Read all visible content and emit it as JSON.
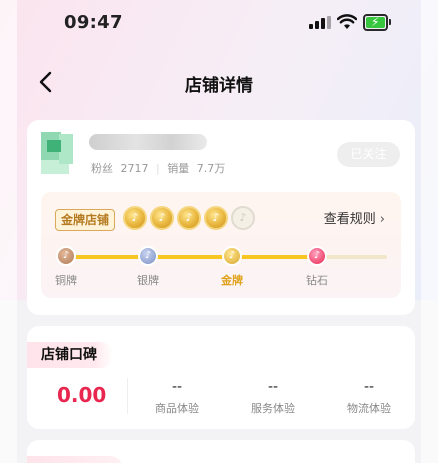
{
  "status_bar": {
    "time": "09:47",
    "battery_bolt": "⚡"
  },
  "nav": {
    "title": "店铺详情",
    "back_icon": "‹"
  },
  "store": {
    "fans_label": "粉丝",
    "fans_value": "2717",
    "sales_label": "销量",
    "sales_value": "7.7万",
    "follow_label": "已关注"
  },
  "tier": {
    "badge_label": "金牌店铺",
    "rules_label": "查看规则",
    "coins_filled": 4,
    "coins_total": 5,
    "levels": [
      {
        "label": "铜牌",
        "active": false
      },
      {
        "label": "银牌",
        "active": false
      },
      {
        "label": "金牌",
        "active": true
      },
      {
        "label": "钻石",
        "active": false
      }
    ]
  },
  "rating": {
    "title": "店铺口碑",
    "score": "0.00",
    "metrics": [
      {
        "value": "--",
        "label": "商品体验"
      },
      {
        "value": "--",
        "label": "服务体验"
      },
      {
        "value": "--",
        "label": "物流体验"
      }
    ]
  },
  "colors": {
    "accent_pink": "#e8264f",
    "gold": "#f7c623"
  }
}
